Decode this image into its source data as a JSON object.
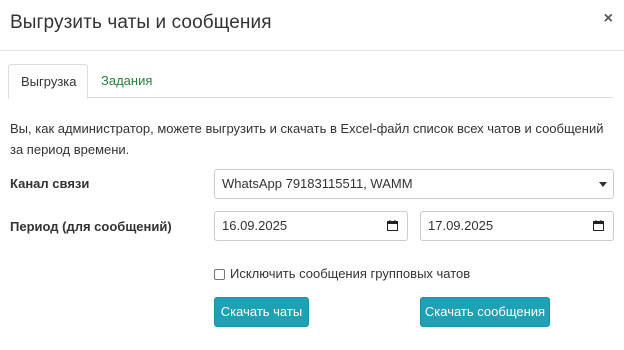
{
  "dialog": {
    "title": "Выгрузить чаты и сообщения",
    "close_label": "×"
  },
  "tabs": [
    {
      "label": "Выгрузка",
      "active": true
    },
    {
      "label": "Задания",
      "active": false
    }
  ],
  "description": "Вы, как администратор, можете выгрузить и скачать в Excel-файл список всех чатов и сообщений за период времени.",
  "form": {
    "channel": {
      "label": "Канал связи",
      "value": "WhatsApp 79183115511, WAMM"
    },
    "period": {
      "label": "Период (для сообщений)",
      "from": "16.09.2025",
      "to": "17.09.2025"
    },
    "exclude_group": {
      "label": "Исключить сообщения групповых чатов",
      "checked": false
    }
  },
  "buttons": {
    "download_chats": "Скачать чаты",
    "download_messages": "Скачать сообщения"
  },
  "colors": {
    "accent_button": "#1fa0b5",
    "tab_link": "#27813a"
  },
  "icons": {
    "close": "close-icon",
    "select": "chevron-down-icon",
    "calendar": "calendar-icon"
  }
}
